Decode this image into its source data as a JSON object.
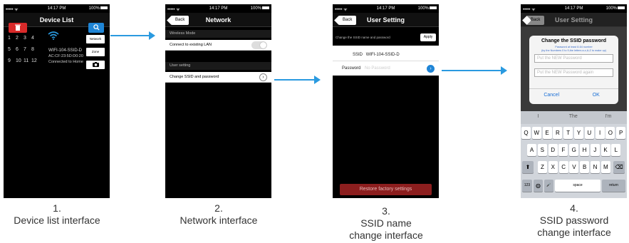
{
  "status": {
    "signal": "••••• ᯤ",
    "time": "14:17 PM",
    "battery": "100%"
  },
  "screen1": {
    "title": "Device List",
    "rows": [
      {
        "n1": "1",
        "n2": "2",
        "n3": "3",
        "n4": "4"
      },
      {
        "n1": "5",
        "n2": "6",
        "n3": "7",
        "n4": "8"
      },
      {
        "n1": "9",
        "n2": "10",
        "n3": "11",
        "n4": "12"
      }
    ],
    "device_name": "WIFI-104-SSID-D",
    "device_mac": "AC:CF:23:5D:D0:20",
    "device_status": "Connected to Home",
    "network_btn": "Network",
    "zone_btn": "Zone",
    "search_icon": "search-icon",
    "camera_icon": "camera-icon"
  },
  "screen2": {
    "back": "Back",
    "title": "Network",
    "wireless_section": "Wireless Mode",
    "connect_label": "Connect to existing LAN",
    "user_section": "User setting",
    "change_label": "Change SSID and password"
  },
  "screen3": {
    "back": "Back",
    "title": "User Setting",
    "header_hint": "Change the SSID name and password",
    "apply": "Apply",
    "ssid_label": "SSID",
    "ssid_value": "WIFI-104-SSID-D",
    "password_label": "Password",
    "password_placeholder": "No Password",
    "restore": "Restore factory settings"
  },
  "screen4": {
    "back": "Back",
    "title": "User Setting",
    "dialog_title": "Change the SSID password",
    "hint1": "Password at least 8-64 number",
    "hint2": "(by the Numbers 0 to 9,the letters a-z,A-Z to make up)",
    "field1": "Put the NEW Password",
    "field2": "Put the NEW Password again",
    "cancel": "Cancel",
    "ok": "OK",
    "suggestions": [
      "I",
      "The",
      "I'm"
    ],
    "row1": [
      "Q",
      "W",
      "E",
      "R",
      "T",
      "Y",
      "U",
      "I",
      "O",
      "P"
    ],
    "row2": [
      "A",
      "S",
      "D",
      "F",
      "G",
      "H",
      "J",
      "K",
      "L"
    ],
    "row3": [
      "Z",
      "X",
      "C",
      "V",
      "B",
      "N",
      "M"
    ],
    "num_key": "123",
    "space": "space",
    "return": "return"
  },
  "captions": {
    "c1_num": "1.",
    "c1_text": "Device list interface",
    "c2_num": "2.",
    "c2_text": "Network interface",
    "c3_num": "3.",
    "c3_text1": "SSID name",
    "c3_text2": "change  interface",
    "c4_num": "4.",
    "c4_text1": "SSID password",
    "c4_text2": "change  interface"
  },
  "colors": {
    "accent": "#2a9ae0",
    "red": "#d92a2a",
    "dark_red": "#8c1e1e"
  }
}
